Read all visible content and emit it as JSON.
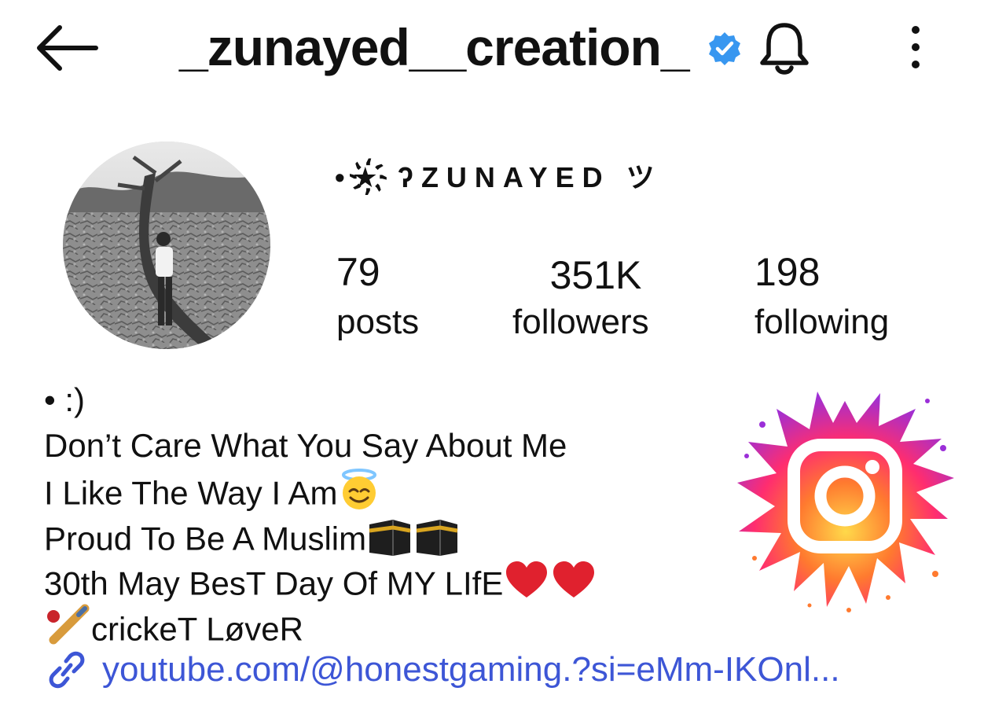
{
  "header": {
    "username": "_zunayed__creation_",
    "icons": [
      "back-arrow-icon",
      "verified-badge-icon",
      "bell-icon",
      "more-vertical-icon"
    ]
  },
  "profile": {
    "display_name": "•★҉ʔZUNAYED ツ",
    "stats": {
      "posts": {
        "count": "79",
        "label": "posts"
      },
      "followers": {
        "count": "351K",
        "label": "followers"
      },
      "following": {
        "count": "198",
        "label": "following"
      }
    }
  },
  "bio": {
    "line1": "• :)",
    "line2": "Don’t Care What You Say About Me",
    "line3": "I Like The Way I Am",
    "line4": "Proud To Be A Muslim",
    "line5": "30th May BesT Day Of MY LIfE",
    "line6": "crickeT LøveR",
    "emojis": [
      "smiling-face-with-halo",
      "kaaba",
      "kaaba",
      "red-heart",
      "red-heart",
      "cricket-bat"
    ]
  },
  "link": {
    "text": "youtube.com/@honestgaming.?si=eMm-IKOnl..."
  },
  "colors": {
    "verified": "#3897f0",
    "link": "#3d56d6",
    "heart": "#e0212e"
  }
}
